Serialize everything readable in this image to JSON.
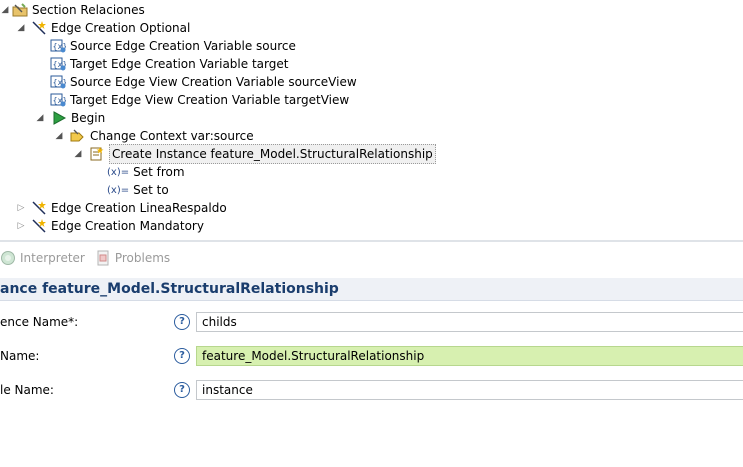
{
  "tree": {
    "section": {
      "label": "Section Relaciones",
      "icon": "section-folder-icon"
    },
    "edge_optional": {
      "label": "Edge Creation Optional",
      "icon": "edge-creation-icon"
    },
    "source_var": {
      "label": "Source Edge Creation Variable source",
      "icon": "variable-icon"
    },
    "target_var": {
      "label": "Target Edge Creation Variable target",
      "icon": "variable-icon"
    },
    "source_view_var": {
      "label": "Source Edge View Creation Variable sourceView",
      "icon": "variable-icon"
    },
    "target_view_var": {
      "label": "Target Edge View Creation Variable targetView",
      "icon": "variable-icon"
    },
    "begin": {
      "label": "Begin",
      "icon": "begin-play-icon"
    },
    "change_context": {
      "label": "Change Context var:source",
      "icon": "change-context-icon"
    },
    "create_instance": {
      "label": "Create Instance feature_Model.StructuralRelationship",
      "icon": "create-instance-icon"
    },
    "set_from": {
      "label": "Set from",
      "icon": "set-value-icon",
      "glyph": "(x)="
    },
    "set_to": {
      "label": "Set to",
      "icon": "set-value-icon",
      "glyph": "(x)="
    },
    "edge_linea": {
      "label": "Edge Creation LineaRespaldo",
      "icon": "edge-creation-icon"
    },
    "edge_mandatory": {
      "label": "Edge Creation Mandatory",
      "icon": "edge-creation-icon"
    }
  },
  "tabs": [
    {
      "label": "Interpreter",
      "icon": "interpreter-icon"
    },
    {
      "label": "Problems",
      "icon": "problems-icon"
    }
  ],
  "properties": {
    "title": "ance feature_Model.StructuralRelationship",
    "help_glyph": "?",
    "rows": [
      {
        "label": "ence Name*:",
        "value": "childs"
      },
      {
        "label": "Name:",
        "value": "feature_Model.StructuralRelationship"
      },
      {
        "label": "le Name:",
        "value": "instance"
      }
    ]
  },
  "colors": {
    "title_text": "#1a3d6d",
    "highlight_field": "#d7f0b0",
    "help_icon": "#2b5c9e"
  }
}
